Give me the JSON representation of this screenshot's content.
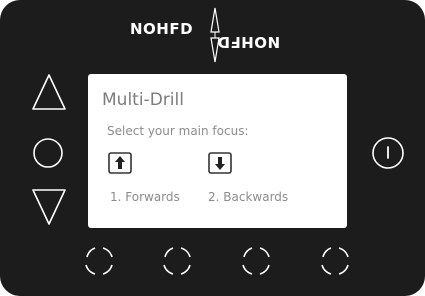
{
  "device": {
    "logo_top": "NOHFD",
    "logo_bottom": "NOHFD"
  },
  "screen": {
    "title": "Multi-Drill",
    "subtitle": "Select your main focus:",
    "options": [
      {
        "label": "1. Forwards",
        "icon": "arrow-up-icon"
      },
      {
        "label": "2. Backwards",
        "icon": "arrow-down-icon"
      }
    ]
  },
  "colors": {
    "device_body": "#1c1c1c",
    "screen_bg": "#ffffff",
    "screen_text": "#8a8a8a",
    "button_outline": "#ffffff"
  }
}
